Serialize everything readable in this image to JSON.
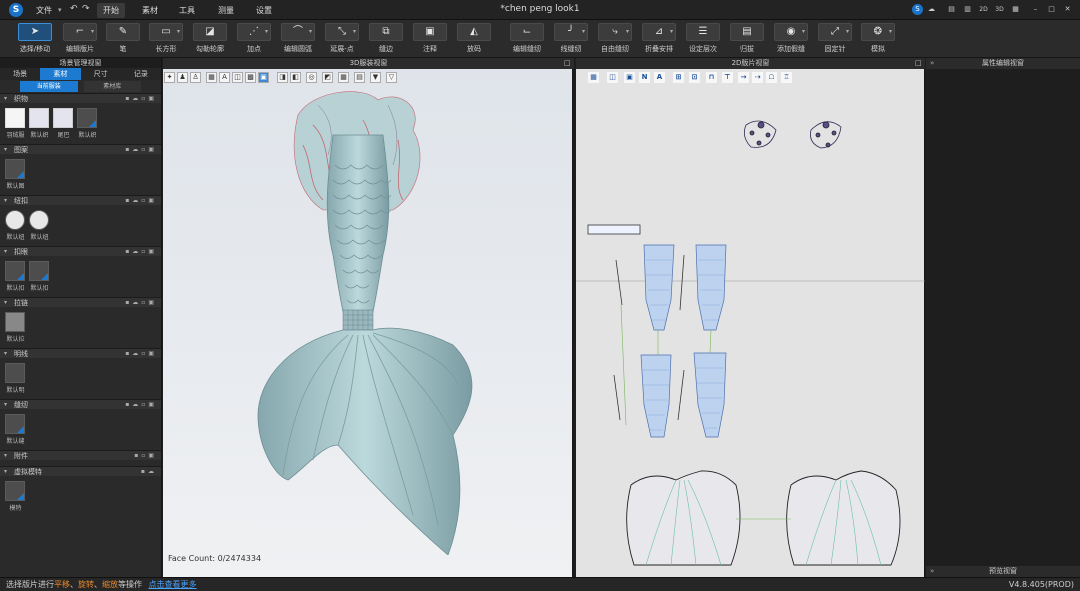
{
  "titlebar": {
    "logo": "S",
    "menu": [
      "文件",
      "开始",
      "素材",
      "工具",
      "测量",
      "设置"
    ],
    "active_menu": "开始",
    "document_title": "*chen peng look1",
    "right_icons": [
      "2D",
      "3D"
    ]
  },
  "toolbar": {
    "tools": [
      {
        "label": "选择/移动",
        "icon": "cursor-icon"
      },
      {
        "label": "编辑版片",
        "icon": "edit-pattern-icon"
      },
      {
        "label": "笔",
        "icon": "pen-icon"
      },
      {
        "label": "长方形",
        "icon": "rectangle-icon"
      },
      {
        "label": "勾勒轮廓",
        "icon": "trace-outline-icon"
      },
      {
        "label": "加点",
        "icon": "add-point-icon"
      },
      {
        "label": "编辑圆弧",
        "icon": "edit-arc-icon"
      },
      {
        "label": "延展-点",
        "icon": "extend-point-icon"
      },
      {
        "label": "缝边",
        "icon": "seam-edge-icon"
      },
      {
        "label": "注释",
        "icon": "note-icon"
      },
      {
        "label": "放码",
        "icon": "grading-icon"
      },
      {
        "label": "编辑缝纫",
        "icon": "edit-sewing-icon"
      },
      {
        "label": "线缝纫",
        "icon": "line-sewing-icon"
      },
      {
        "label": "自由缝纫",
        "icon": "free-sewing-icon"
      },
      {
        "label": "折叠安排",
        "icon": "fold-arrange-icon"
      },
      {
        "label": "设定层次",
        "icon": "layer-icon"
      },
      {
        "label": "归拔",
        "icon": "shrink-icon"
      },
      {
        "label": "添加假缝",
        "icon": "tack-icon"
      },
      {
        "label": "固定针",
        "icon": "pin-icon"
      },
      {
        "label": "模拟",
        "icon": "simulate-icon"
      }
    ]
  },
  "left_panel": {
    "title": "场景管理视窗",
    "tabs": [
      "场景",
      "素材",
      "尺寸",
      "记录"
    ],
    "active_tab": "素材",
    "subtabs": [
      "当前服装",
      "素材库"
    ],
    "active_subtab": "当前服装",
    "sections": [
      {
        "title": "织物",
        "items": [
          {
            "label": "羽绒服",
            "style": "white"
          },
          {
            "label": "默认织",
            "style": "light"
          },
          {
            "label": "尾巴",
            "style": "light"
          },
          {
            "label": "默认织",
            "style": "dark"
          }
        ]
      },
      {
        "title": "图案",
        "items": [
          {
            "label": "默认图",
            "style": "dark"
          }
        ]
      },
      {
        "title": "纽扣",
        "items": [
          {
            "label": "默认纽",
            "style": "round"
          },
          {
            "label": "默认纽",
            "style": "round"
          }
        ]
      },
      {
        "title": "扣眼",
        "items": [
          {
            "label": "默认扣",
            "style": "dark"
          },
          {
            "label": "默认扣",
            "style": "dark"
          }
        ]
      },
      {
        "title": "拉链",
        "items": [
          {
            "label": "默认拉",
            "style": "dark"
          }
        ]
      },
      {
        "title": "明线",
        "items": [
          {
            "label": "默认明",
            "style": "dark"
          }
        ]
      },
      {
        "title": "缝纫",
        "items": [
          {
            "label": "默认缝",
            "style": "dark"
          }
        ]
      },
      {
        "title": "附件",
        "items": []
      },
      {
        "title": "虚拟模特",
        "items": [
          {
            "label": "模特",
            "style": "dark"
          }
        ]
      }
    ]
  },
  "view3d": {
    "title": "3D服装视窗",
    "face_count": "Face Count: 0/2474334"
  },
  "view2d": {
    "title": "2D版片视窗"
  },
  "right_panel": {
    "title": "属性编辑视窗",
    "preview_title": "预览视窗"
  },
  "statusbar": {
    "text_prefix": "选择版片进行",
    "action1": "平移",
    "sep1": "、",
    "action2": "旋转",
    "sep2": "、",
    "action3": "缩放",
    "text_suffix": "等操作",
    "link": "点击查看更多",
    "version": "V4.8.405(PROD)"
  },
  "colors": {
    "accent": "#1d7ad1",
    "status_highlight": "#e8892c",
    "mermaid_tail": "#a9c9cc"
  }
}
